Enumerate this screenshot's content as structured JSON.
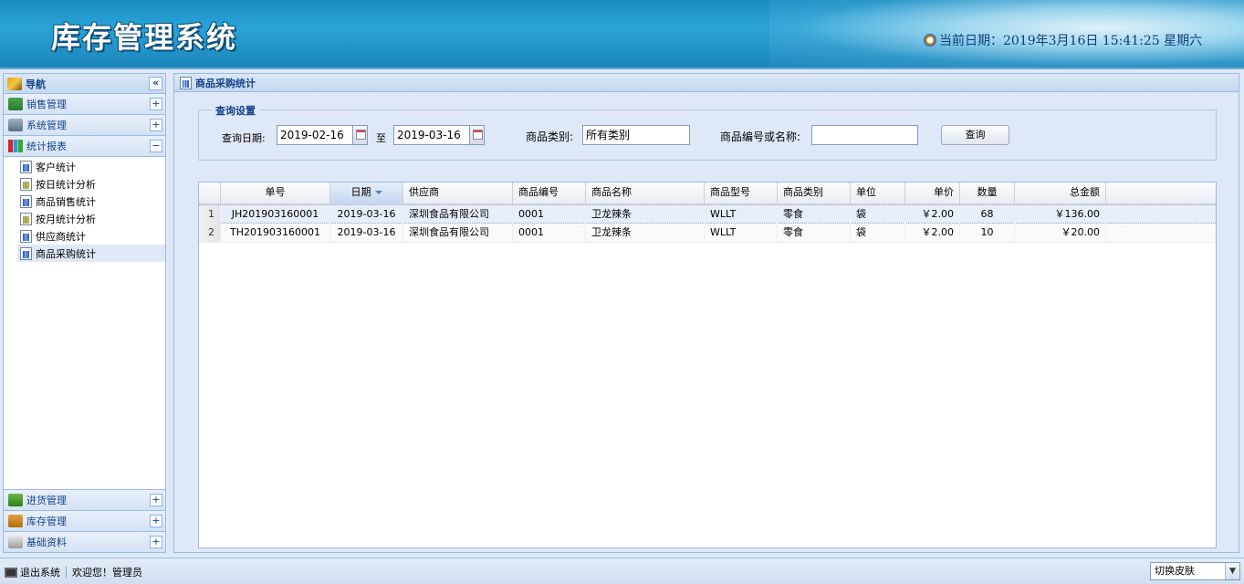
{
  "header": {
    "title": "库存管理系统",
    "date_text": "当前日期：2019年3月16日  15:41:25 星期六"
  },
  "sidebar": {
    "title": "导航",
    "collapse_symbol": "«",
    "top_items": [
      {
        "label": "销售管理",
        "sign": "+"
      },
      {
        "label": "系统管理",
        "sign": "+"
      },
      {
        "label": "统计报表",
        "sign": "−"
      }
    ],
    "tree_items": [
      {
        "label": "客户统计"
      },
      {
        "label": "按日统计分析"
      },
      {
        "label": "商品销售统计"
      },
      {
        "label": "按月统计分析"
      },
      {
        "label": "供应商统计"
      },
      {
        "label": "商品采购统计"
      }
    ],
    "bottom_items": [
      {
        "label": "进货管理",
        "sign": "+"
      },
      {
        "label": "库存管理",
        "sign": "+"
      },
      {
        "label": "基础资料",
        "sign": "+"
      }
    ]
  },
  "main": {
    "title": "商品采购统计",
    "query": {
      "legend": "查询设置",
      "date_label": "查询日期:",
      "start_date": "2019-02-16",
      "to_label": "至",
      "end_date": "2019-03-16",
      "category_label": "商品类别:",
      "category_value": "所有类别",
      "code_label": "商品编号或名称:",
      "code_value": "",
      "search_button": "查询"
    },
    "grid": {
      "columns": [
        "单号",
        "日期",
        "供应商",
        "商品编号",
        "商品名称",
        "商品型号",
        "商品类别",
        "单位",
        "单价",
        "数量",
        "总金额"
      ],
      "rows": [
        {
          "num": "1",
          "cells": [
            "JH201903160001",
            "2019-03-16",
            "深圳食品有限公司",
            "0001",
            "卫龙辣条",
            "WLLT",
            "零食",
            "袋",
            "￥2.00",
            "68",
            "￥136.00"
          ]
        },
        {
          "num": "2",
          "cells": [
            "TH201903160001",
            "2019-03-16",
            "深圳食品有限公司",
            "0001",
            "卫龙辣条",
            "WLLT",
            "零食",
            "袋",
            "￥2.00",
            "10",
            "￥20.00"
          ]
        }
      ]
    }
  },
  "footer": {
    "logout": "退出系统",
    "welcome": "欢迎您！管理员",
    "skin_select": "切换皮肤"
  }
}
